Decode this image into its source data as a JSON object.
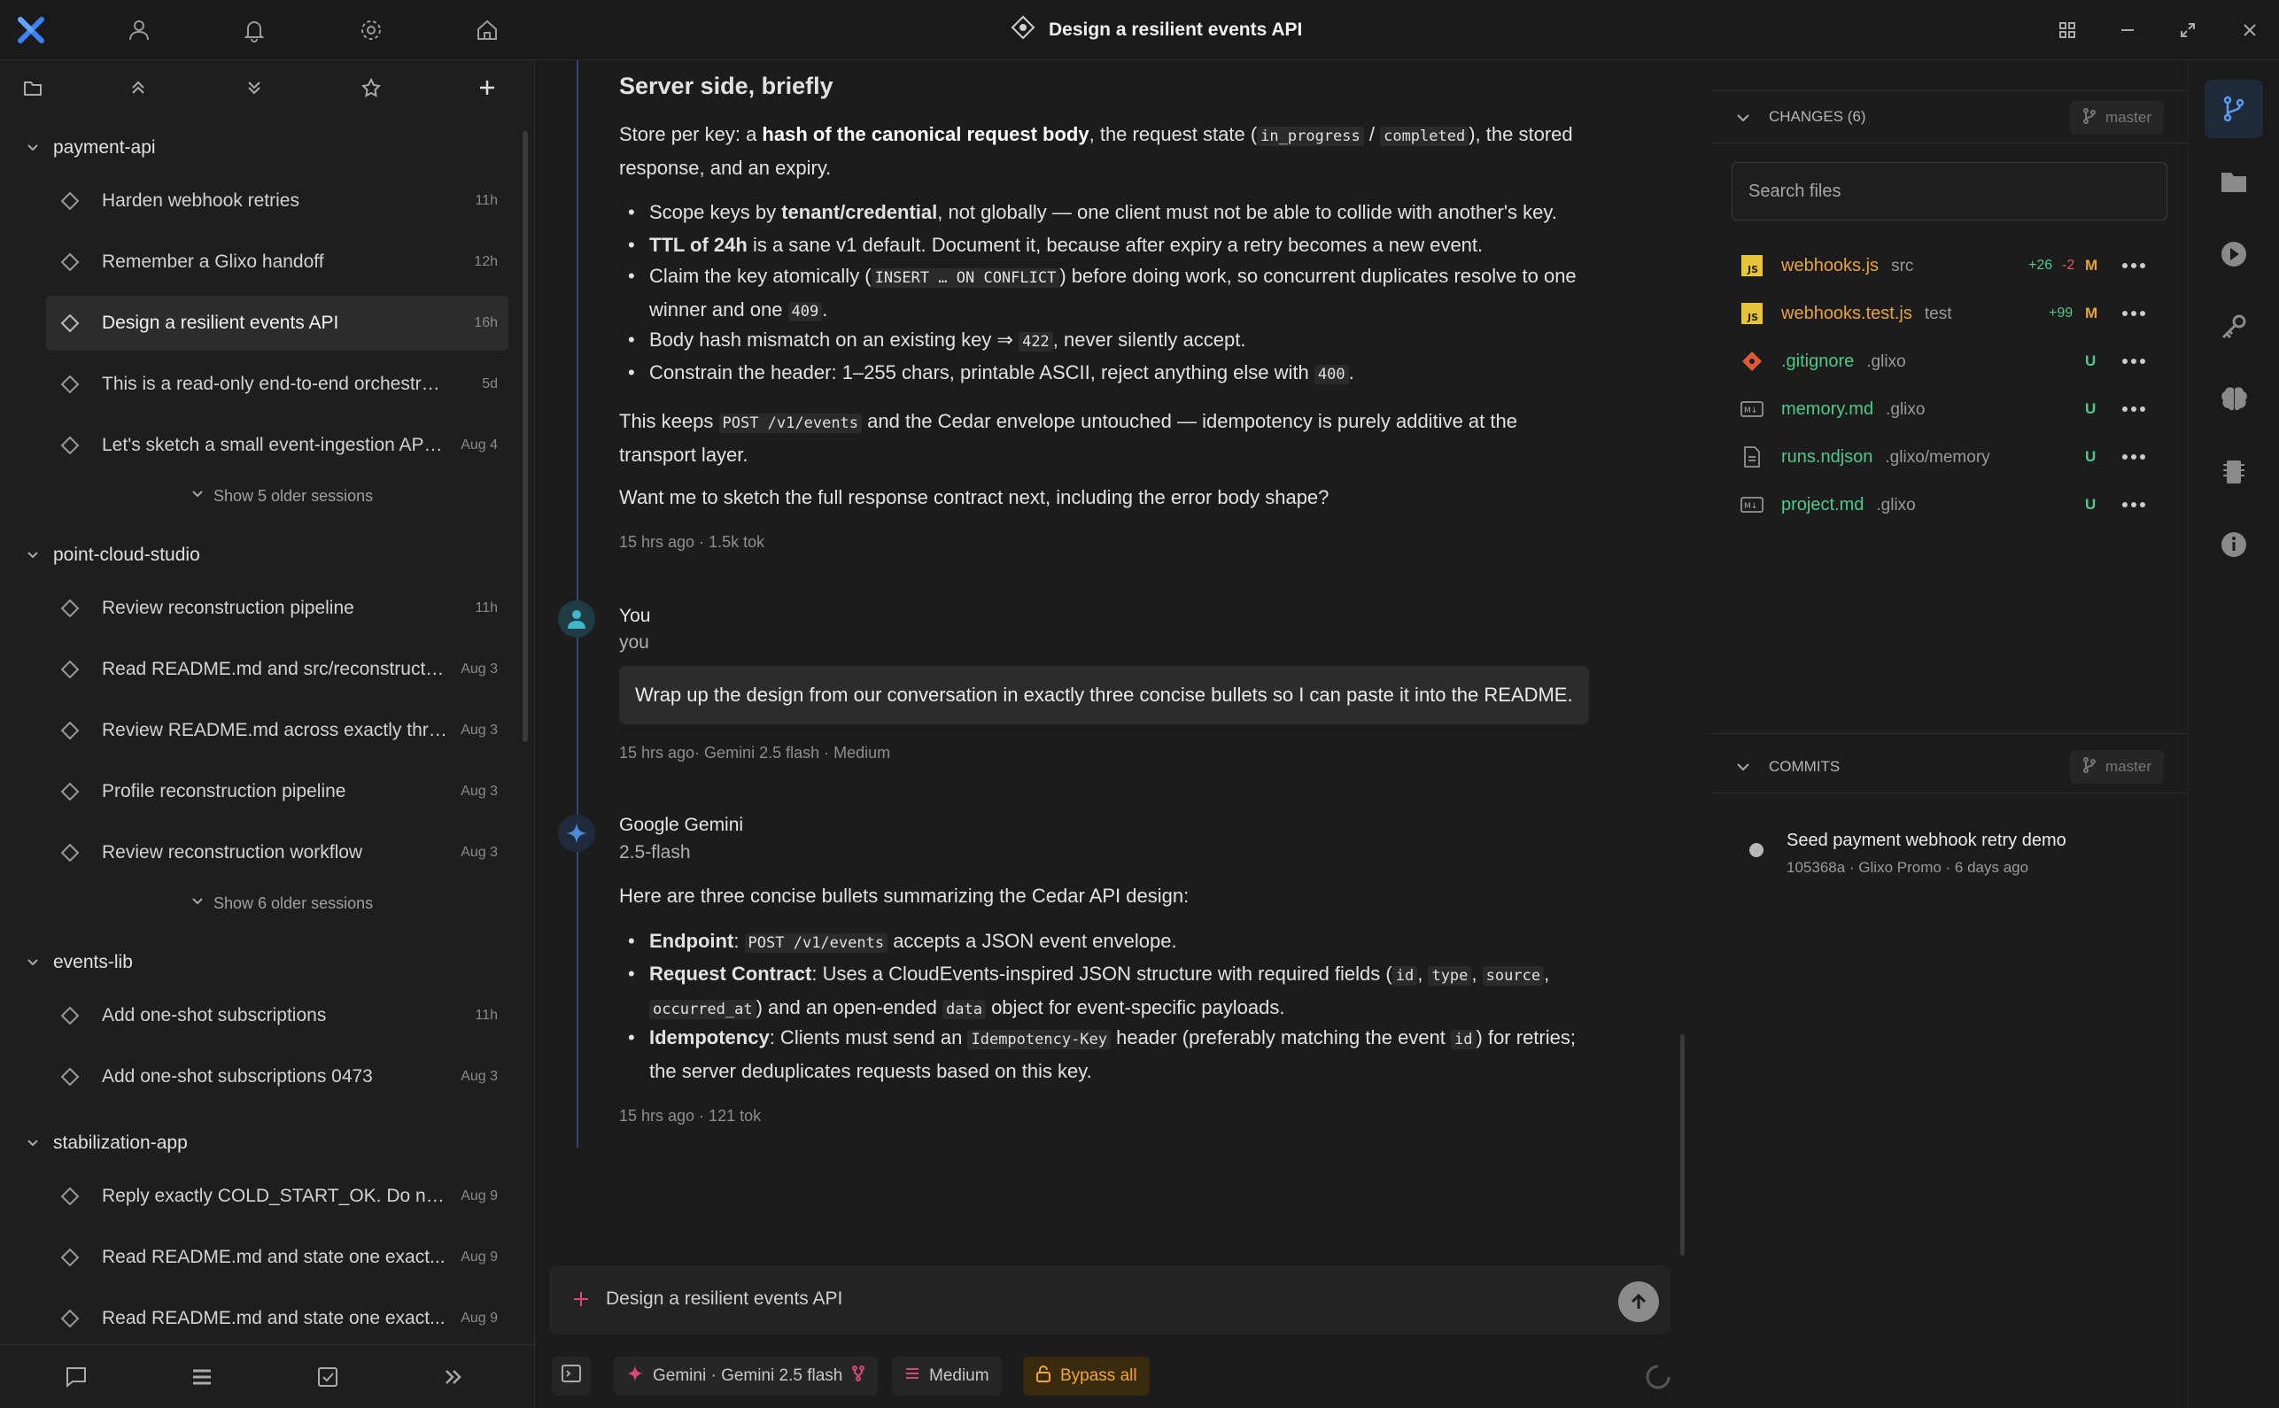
{
  "window": {
    "title": "Design a resilient events API"
  },
  "sidebar": {
    "groups": [
      {
        "name": "payment-api",
        "sessions": [
          {
            "title": "Harden webhook retries",
            "age": "11h"
          },
          {
            "title": "Remember a Glixo handoff",
            "age": "12h"
          },
          {
            "title": "Design a resilient events API",
            "age": "16h"
          },
          {
            "title": "This is a read-only end-to-end orchestratio...",
            "age": "5d"
          },
          {
            "title": "Let's sketch a small event-ingestion API. ...",
            "age": "Aug 4"
          }
        ],
        "more": "Show 5 older sessions"
      },
      {
        "name": "point-cloud-studio",
        "sessions": [
          {
            "title": "Review reconstruction pipeline",
            "age": "11h"
          },
          {
            "title": "Read README.md and src/reconstruct.p...",
            "age": "Aug 3"
          },
          {
            "title": "Review README.md across exactly three...",
            "age": "Aug 3"
          },
          {
            "title": "Profile reconstruction pipeline",
            "age": "Aug 3"
          },
          {
            "title": "Review reconstruction workflow",
            "age": "Aug 3"
          }
        ],
        "more": "Show 6 older sessions"
      },
      {
        "name": "events-lib",
        "sessions": [
          {
            "title": "Add one-shot subscriptions",
            "age": "11h"
          },
          {
            "title": "Add one-shot subscriptions 0473",
            "age": "Aug 3"
          }
        ]
      },
      {
        "name": "stabilization-app",
        "sessions": [
          {
            "title": "Reply exactly COLD_START_OK. Do not u...",
            "age": "Aug 9"
          },
          {
            "title": "Read README.md and state one exact...",
            "age": "Aug 9"
          },
          {
            "title": "Read README.md and state one exact...",
            "age": "Aug 9"
          }
        ]
      }
    ]
  },
  "conversation": {
    "heading": "Server side, briefly",
    "p1_a": "Store per key: a ",
    "p1_b": "hash of the canonical request body",
    "p1_c": ", the request state (",
    "p1_code1": "in_progress",
    "p1_d": " / ",
    "p1_code2": "completed",
    "p1_e": "), the stored response, and an expiry.",
    "b1_a": "Scope keys by ",
    "b1_b": "tenant/credential",
    "b1_c": ", not globally — one client must not be able to collide with another's key.",
    "b2_a": "TTL of 24h",
    "b2_b": " is a sane v1 default. Document it, because after expiry a retry becomes a new event.",
    "b3_a": "Claim the key atomically (",
    "b3_code": "INSERT … ON CONFLICT",
    "b3_b": ") before doing work, so concurrent duplicates resolve to one winner and one ",
    "b3_code2": "409",
    "b3_c": ".",
    "b4_a": "Body hash mismatch on an existing key ⇒ ",
    "b4_code": "422",
    "b4_b": ", never silently accept.",
    "b5_a": "Constrain the header: 1–255 chars, printable ASCII, reject anything else with ",
    "b5_code": "400",
    "b5_b": ".",
    "p2_a": "This keeps ",
    "p2_code": "POST /v1/events",
    "p2_b": " and the Cedar envelope untouched — idempotency is purely additive at the transport layer.",
    "p3": "Want me to sketch the full response contract next, including the error body shape?",
    "meta1": "15 hrs ago · 1.5k tok",
    "user_name": "You",
    "user_sub": "you",
    "user_msg": "Wrap up the design from our conversation in exactly three concise bullets so I can paste it into the README.",
    "meta2": "15 hrs ago· Gemini 2.5 flash · Medium",
    "bot_name": "Google Gemini",
    "bot_sub": "2.5-flash",
    "r_intro": "Here are three concise bullets summarizing the Cedar API design:",
    "r1_a": "Endpoint",
    "r1_b": ": ",
    "r1_code": "POST /v1/events",
    "r1_c": " accepts a JSON event envelope.",
    "r2_a": "Request Contract",
    "r2_b": ": Uses a CloudEvents-inspired JSON structure with required fields (",
    "r2_c1": "id",
    "r2_sep": ", ",
    "r2_c2": "type",
    "r2_c3": "source",
    "r2_c4": "occurred_at",
    "r2_d": ") and an open-ended ",
    "r2_c5": "data",
    "r2_e": " object for event-specific payloads.",
    "r3_a": "Idempotency",
    "r3_b": ": Clients must send an ",
    "r3_code": "Idempotency-Key",
    "r3_c": " header (preferably matching the event ",
    "r3_code2": "id",
    "r3_d": ") for retries; the server deduplicates requests based on this key.",
    "meta3": "15 hrs ago · 121 tok"
  },
  "composer": {
    "placeholder": "Design a resilient events API",
    "model_chip": "Gemini · Gemini 2.5 flash",
    "effort_chip": "Medium",
    "bypass_chip": "Bypass all"
  },
  "changes": {
    "header": "CHANGES (6)",
    "branch": "master",
    "search_placeholder": "Search files",
    "files": [
      {
        "name": "webhooks.js",
        "dir": "src",
        "add": "+26",
        "del": "-2",
        "status": "M"
      },
      {
        "name": "webhooks.test.js",
        "dir": "test",
        "add": "+99",
        "status": "M"
      },
      {
        "name": ".gitignore",
        "dir": ".glixo",
        "status": "U"
      },
      {
        "name": "memory.md",
        "dir": ".glixo",
        "status": "U"
      },
      {
        "name": "runs.ndjson",
        "dir": ".glixo/memory",
        "status": "U"
      },
      {
        "name": "project.md",
        "dir": ".glixo",
        "status": "U"
      }
    ]
  },
  "commits": {
    "header": "COMMITS",
    "branch": "master",
    "items": [
      {
        "title": "Seed payment webhook retry demo",
        "meta": "105368a · Glixo Promo · 6 days ago"
      }
    ]
  },
  "colors": {
    "accent": "#4a8bd6",
    "modified": "#e8a33d",
    "untracked": "#4fc98a",
    "warn": "#f0a830"
  }
}
